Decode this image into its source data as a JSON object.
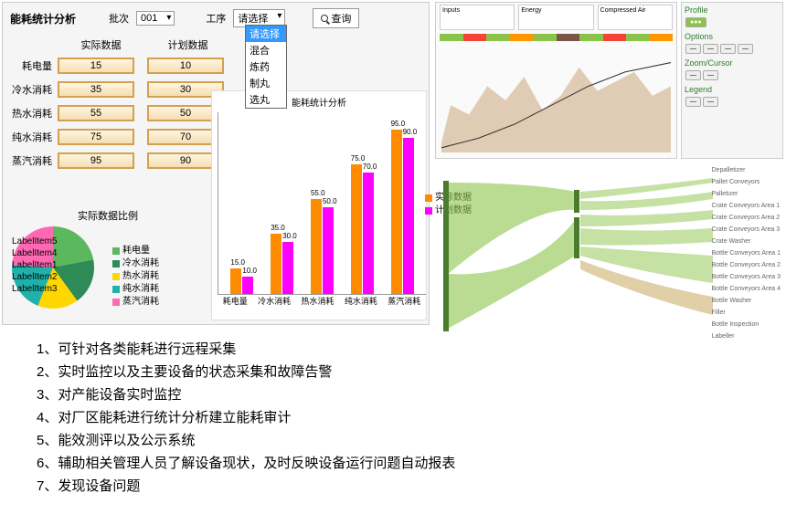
{
  "panel_tl": {
    "title": "能耗统计分析",
    "batch_label": "批次",
    "batch_value": "001",
    "process_label": "工序",
    "process_value": "请选择",
    "dropdown_options": [
      "请选择",
      "混合",
      "炼药",
      "制丸",
      "选丸"
    ],
    "search_label": "查询",
    "col_actual": "实际数据",
    "col_planned": "计划数据",
    "rows": [
      {
        "label": "耗电量",
        "actual": "15",
        "planned": "10"
      },
      {
        "label": "冷水消耗",
        "actual": "35",
        "planned": "30"
      },
      {
        "label": "热水消耗",
        "actual": "55",
        "planned": "50"
      },
      {
        "label": "纯水消耗",
        "actual": "75",
        "planned": "70"
      },
      {
        "label": "蒸汽消耗",
        "actual": "95",
        "planned": "90"
      }
    ],
    "pie": {
      "title": "实际数据比例",
      "labels": [
        "LabelItem5",
        "LabelItem4",
        "LabelItem1",
        "LabelItem2",
        "LabelItem3"
      ],
      "legend": [
        {
          "name": "耗电量",
          "color": "#5cb85c"
        },
        {
          "name": "冷水消耗",
          "color": "#2e8b57"
        },
        {
          "name": "热水消耗",
          "color": "#ffd700"
        },
        {
          "name": "纯水消耗",
          "color": "#20b2aa"
        },
        {
          "name": "蒸汽消耗",
          "color": "#ff69b4"
        }
      ]
    }
  },
  "chart_data": {
    "type": "bar",
    "title": "能耗统计分析",
    "categories": [
      "耗电量",
      "冷水消耗",
      "热水消耗",
      "纯水消耗",
      "蒸汽消耗"
    ],
    "series": [
      {
        "name": "实际数据",
        "values": [
          15,
          35,
          55,
          75,
          95
        ],
        "color": "#ff8c00"
      },
      {
        "name": "计划数据",
        "values": [
          10,
          30,
          50,
          70,
          90
        ],
        "color": "#ff00ff"
      }
    ],
    "ylim": [
      0,
      100
    ],
    "xlabel": "",
    "ylabel": ""
  },
  "panel_tr1": {
    "boxes": [
      "Inputs",
      "Energy",
      "Compressed Air"
    ]
  },
  "panel_tr2": {
    "sections": {
      "profile": "Profile",
      "options": "Options",
      "zoom": "Zoom/Cursor",
      "legend": "Legend"
    }
  },
  "sankey": {
    "endpoints": [
      "Depalletizer",
      "Pallet Conveyors",
      "Palletizer",
      "Crate Conveyors Area 1",
      "Crate Conveyors Area 2",
      "Crate Conveyors Area 3",
      "Crate Washer",
      "Bottle Conveyors Area 1",
      "Bottle Conveyors Area 2",
      "Bottle Conveyors Area 3",
      "Bottle Conveyors Area 4",
      "Bottle Washer",
      "Filler",
      "Bottle Inspection",
      "Labeller"
    ]
  },
  "features": [
    "1、可针对各类能耗进行远程采集",
    "2、实时监控以及主要设备的状态采集和故障告警",
    "3、对产能设备实时监控",
    "4、对厂区能耗进行统计分析建立能耗审计",
    "5、能效测评以及公示系统",
    "6、辅助相关管理人员了解设备现状，及时反映设备运行问题自动报表",
    "7、发现设备问题"
  ]
}
